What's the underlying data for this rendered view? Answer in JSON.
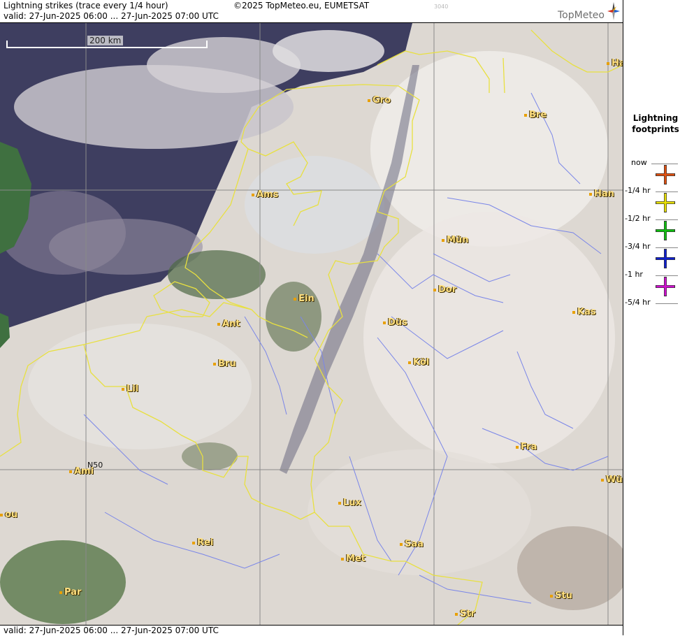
{
  "header": {
    "title": "Lightning strikes (trace every 1/4 hour)",
    "copyright": "©2025 TopMeteo.eu, EUMETSAT",
    "code": "3040",
    "valid": "valid:  27-Jun-2025 06:00 ... 27-Jun-2025 07:00 UTC",
    "logo": "TopMeteo"
  },
  "footer": {
    "valid": "valid:  27-Jun-2025 06:00 ... 27-Jun-2025 07:00 UTC"
  },
  "map": {
    "scale_label": "200 km",
    "latitude_label": "N50",
    "cities": [
      {
        "name": "Gro"
      },
      {
        "name": "Bre"
      },
      {
        "name": "Ha"
      },
      {
        "name": "Ams"
      },
      {
        "name": "Han"
      },
      {
        "name": "Mün"
      },
      {
        "name": "Dor"
      },
      {
        "name": "Ein"
      },
      {
        "name": "Ant"
      },
      {
        "name": "Düs"
      },
      {
        "name": "Kas"
      },
      {
        "name": "Bru"
      },
      {
        "name": "Köl"
      },
      {
        "name": "Lil"
      },
      {
        "name": "Fra"
      },
      {
        "name": "Ami"
      },
      {
        "name": "Wü"
      },
      {
        "name": "Lux"
      },
      {
        "name": "ou"
      },
      {
        "name": "Rei"
      },
      {
        "name": "Saa"
      },
      {
        "name": "Met"
      },
      {
        "name": "Par"
      },
      {
        "name": "Stu"
      },
      {
        "name": "Str"
      }
    ]
  },
  "legend": {
    "title_line1": "Lightning",
    "title_line2": "footprints",
    "entries": [
      {
        "label": "now",
        "color": null
      },
      {
        "label": "-1/4 hr",
        "color": "#e05010"
      },
      {
        "label": "-1/2 hr",
        "color": "#e8e000"
      },
      {
        "label": "-3/4 hr",
        "color": "#10c010"
      },
      {
        "label": "-1 hr",
        "color": "#1020d0"
      },
      {
        "label": "-5/4 hr",
        "color": "#d010d0"
      }
    ]
  },
  "colors": {
    "border": "#e8e040",
    "river": "#7a86e8",
    "grid": "#8a8a8a",
    "city_label": "#ffe080"
  }
}
